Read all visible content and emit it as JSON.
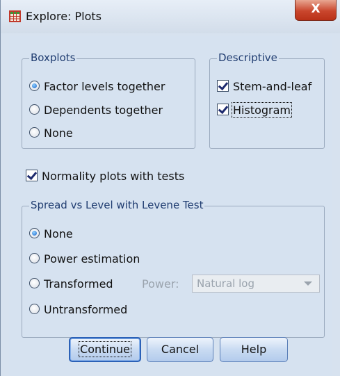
{
  "window": {
    "title": "Explore: Plots",
    "close_label": "X"
  },
  "boxplots": {
    "legend": "Boxplots",
    "options": [
      {
        "label": "Factor levels together",
        "selected": true
      },
      {
        "label": "Dependents together",
        "selected": false
      },
      {
        "label": "None",
        "selected": false
      }
    ]
  },
  "descriptive": {
    "legend": "Descriptive",
    "stem_and_leaf": {
      "label": "Stem-and-leaf",
      "checked": true
    },
    "histogram": {
      "label": "Histogram",
      "checked": true
    }
  },
  "normality": {
    "label": "Normality plots with tests",
    "checked": true
  },
  "spread": {
    "legend": "Spread vs Level with Levene Test",
    "options": [
      {
        "label": "None",
        "selected": true
      },
      {
        "label": "Power estimation",
        "selected": false
      },
      {
        "label": "Transformed",
        "selected": false
      },
      {
        "label": "Untransformed",
        "selected": false
      }
    ],
    "power_label": "Power:",
    "power_value": "Natural log"
  },
  "buttons": {
    "continue": "Continue",
    "cancel": "Cancel",
    "help": "Help"
  }
}
